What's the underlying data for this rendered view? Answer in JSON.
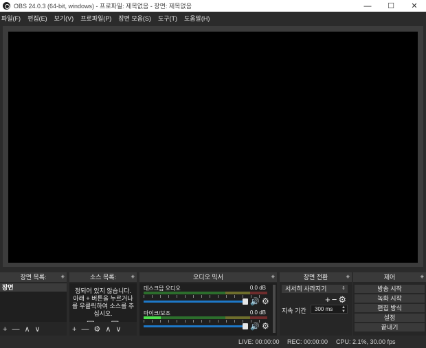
{
  "window": {
    "title": "OBS 24.0.3 (64-bit, windows) - 프로파일: 제목없음 - 장면: 제목없음",
    "minimize": "—",
    "maximize": "☐",
    "close": "✕"
  },
  "menu": [
    "파일(F)",
    "편집(E)",
    "보기(V)",
    "프로파일(P)",
    "장면 모음(S)",
    "도구(T)",
    "도움말(H)"
  ],
  "scenes": {
    "title": "장면 목록:",
    "items": [
      "장면"
    ],
    "toolbar": [
      "+",
      "—",
      "∧",
      "∨"
    ]
  },
  "sources": {
    "title": "소스 목록:",
    "empty_lines": [
      "정되어 있지 않습니다.",
      "아래 + 버튼을 누르거나",
      "를 우클릭하여 소스를 추",
      "십시오."
    ],
    "toolbar": [
      "+",
      "—",
      "⚙",
      "∧",
      "∨"
    ]
  },
  "mixer": {
    "title": "오디오 믹서",
    "channels": [
      {
        "name": "데스크탑 오디오",
        "db": "0.0 dB",
        "level": 0.0
      },
      {
        "name": "마이크/보조",
        "db": "0.0 dB",
        "level": 0.14
      }
    ]
  },
  "transitions": {
    "title": "장면 전환",
    "selected": "서서히 사라지기",
    "duration_label": "지속 기간",
    "duration_value": "300 ms"
  },
  "controls": {
    "title": "제어",
    "buttons": [
      "방송 시작",
      "녹화 시작",
      "편집 방식",
      "설정",
      "끝내기"
    ]
  },
  "status": {
    "live": "LIVE: 00:00:00",
    "rec": "REC: 00:00:00",
    "cpu": "CPU: 2.1%, 30.00 fps"
  }
}
